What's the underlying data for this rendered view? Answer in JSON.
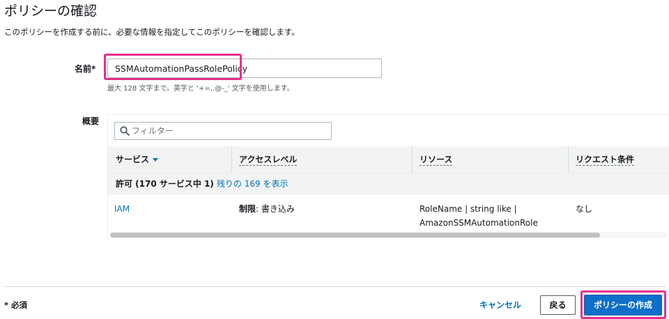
{
  "page": {
    "title": "ポリシーの確認",
    "description": "このポリシーを作成する前に、必要な情報を指定してこのポリシーを確認します。"
  },
  "name_field": {
    "label": "名前*",
    "value": "SSMAutomationPassRolePolicy",
    "hint": "最大 128 文字まで。英字と '+=,.@-_' 文字を使用します。"
  },
  "summary": {
    "label": "概要",
    "filter_placeholder": "フィルター",
    "columns": [
      "サービス",
      "アクセスレベル",
      "リソース",
      "リクエスト条件"
    ],
    "group_row": {
      "text": "許可 (170 サービス中 1)",
      "link": "残りの 169 を表示"
    },
    "rows": [
      {
        "service": "IAM",
        "access_level_bold": "制限",
        "access_level_rest": ": 書き込み",
        "resource_line1": "RoleName | string like |",
        "resource_line2": "AmazonSSMAutomationRole",
        "condition": "なし"
      }
    ]
  },
  "footer": {
    "required_note": "* 必須",
    "cancel_label": "キャンセル",
    "back_label": "戻る",
    "create_label": "ポリシーの作成"
  },
  "colors": {
    "link": "#0073bb",
    "primary": "#0d6fc7",
    "highlight": "#e7308b"
  }
}
